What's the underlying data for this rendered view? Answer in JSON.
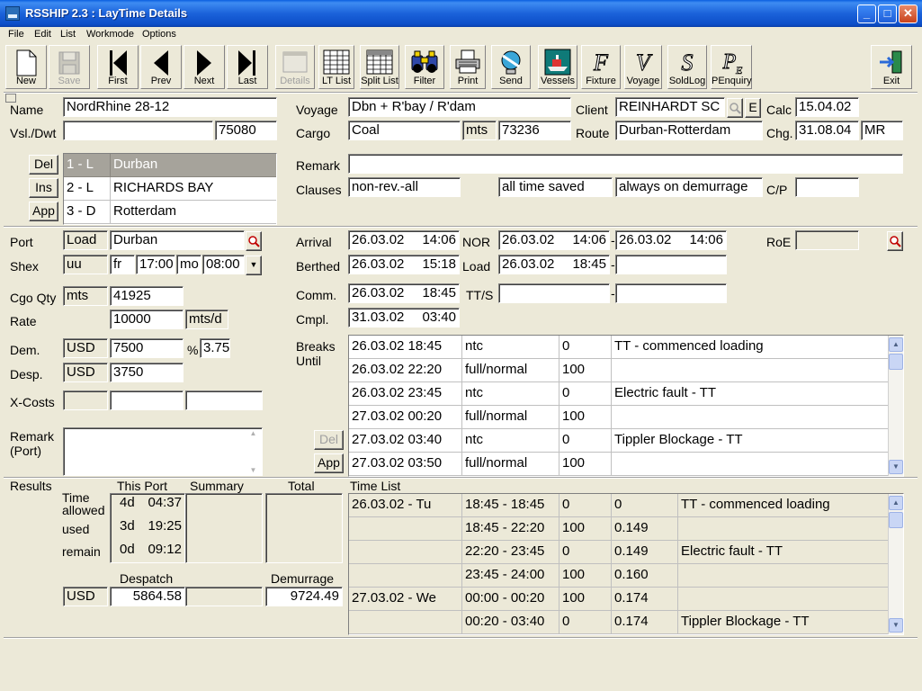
{
  "window": {
    "title": "RSSHIP 2.3 : LayTime Details"
  },
  "menu": [
    "File",
    "Edit",
    "List",
    "Workmode",
    "Options"
  ],
  "toolbar": {
    "new": "New",
    "save": "Save",
    "first": "First",
    "prev": "Prev",
    "next": "Next",
    "last": "Last",
    "details": "Details",
    "lt_list": "LT List",
    "split_list": "Split List",
    "filter": "Filter",
    "print": "Print",
    "send": "Send",
    "vessels": "Vessels",
    "fixture": "Fixture",
    "voyage": "Voyage",
    "soldlog": "SoldLog",
    "penquiry": "PEnquiry",
    "exit": "Exit"
  },
  "header": {
    "name_label": "Name",
    "name_value": "NordRhine 28-12",
    "vsl_dwt_label": "Vsl./Dwt",
    "vsl_value": "",
    "dwt_value": "75080",
    "voyage_label": "Voyage",
    "voyage_value": "Dbn + R'bay / R'dam",
    "cargo_label": "Cargo",
    "cargo_value": "Coal",
    "cargo_unit": "mts",
    "cargo_qty": "73236",
    "client_label": "Client",
    "client_value": "REINHARDT SC",
    "client_e_button": "E",
    "route_label": "Route",
    "route_value": "Durban-Rotterdam",
    "calc_label": "Calc",
    "calc_value": "15.04.02",
    "chg_label": "Chg.",
    "chg_value": "31.08.04",
    "chg_user": "MR",
    "remark_label": "Remark",
    "remark_value": "",
    "clauses_label": "Clauses",
    "clauses": [
      "non-rev.-all",
      "all time saved",
      "always on demurrage"
    ],
    "cp_label": "C/P",
    "cp_value": ""
  },
  "ports": {
    "del_button": "Del",
    "ins_button": "Ins",
    "app_button": "App",
    "rows": [
      {
        "code": "1 - L",
        "name": "Durban"
      },
      {
        "code": "2 - L",
        "name": "RICHARDS BAY"
      },
      {
        "code": "3 - D",
        "name": "Rotterdam"
      }
    ]
  },
  "port_detail": {
    "port_label": "Port",
    "port_type": "Load",
    "port_name": "Durban",
    "shex_label": "Shex",
    "shex_value": "uu",
    "shex_from_day": "fr",
    "shex_from_time": "17:00",
    "shex_to_day": "mo",
    "shex_to_time": "08:00",
    "cgo_qty_label": "Cgo Qty",
    "cgo_unit": "mts",
    "cgo_qty": "41925",
    "rate_label": "Rate",
    "rate_value": "10000",
    "rate_unit": "mts/d",
    "dem_label": "Dem.",
    "dem_currency": "USD",
    "dem_value": "7500",
    "pct_label": "%",
    "pct_value": "3.75",
    "desp_label": "Desp.",
    "desp_currency": "USD",
    "desp_value": "3750",
    "xcosts_label": "X-Costs",
    "remark_port_label_1": "Remark",
    "remark_port_label_2": "(Port)",
    "arrival_label": "Arrival",
    "arrival_date": "26.03.02",
    "arrival_time": "14:06",
    "nor_label": "NOR",
    "nor_from_date": "26.03.02",
    "nor_from_time": "14:06",
    "nor_to_date": "26.03.02",
    "nor_to_time": "14:06",
    "roe_label": "RoE",
    "roe_value": "",
    "berthed_label": "Berthed",
    "berthed_date": "26.03.02",
    "berthed_time": "15:18",
    "load_label": "Load",
    "load_date": "26.03.02",
    "load_time": "18:45",
    "comm_label": "Comm.",
    "comm_date": "26.03.02",
    "comm_time": "18:45",
    "tts_label": "TT/S",
    "cmpl_label": "Cmpl.",
    "cmpl_date": "31.03.02",
    "cmpl_time": "03:40",
    "dash": "-"
  },
  "breaks": {
    "label_1": "Breaks",
    "label_2": "Until",
    "del_button": "Del",
    "app_button": "App",
    "rows": [
      {
        "date": "26.03.02",
        "time": "18:45",
        "type": "ntc",
        "pct": "0",
        "desc": "TT - commenced loading"
      },
      {
        "date": "26.03.02",
        "time": "22:20",
        "type": "full/normal",
        "pct": "100",
        "desc": ""
      },
      {
        "date": "26.03.02",
        "time": "23:45",
        "type": "ntc",
        "pct": "0",
        "desc": "Electric fault - TT"
      },
      {
        "date": "27.03.02",
        "time": "00:20",
        "type": "full/normal",
        "pct": "100",
        "desc": ""
      },
      {
        "date": "27.03.02",
        "time": "03:40",
        "type": "ntc",
        "pct": "0",
        "desc": "Tippler Blockage - TT"
      },
      {
        "date": "27.03.02",
        "time": "03:50",
        "type": "full/normal",
        "pct": "100",
        "desc": ""
      }
    ]
  },
  "results": {
    "label": "Results",
    "this_port_label": "This Port",
    "summary_label": "Summary",
    "total_label": "Total",
    "time_allowed_label_1": "Time",
    "time_allowed_label_2": "allowed",
    "used_label": "used",
    "remain_label": "remain",
    "allowed_d": "4d",
    "allowed_t": "04:37",
    "used_d": "3d",
    "used_t": "19:25",
    "remain_d": "0d",
    "remain_t": "09:12",
    "despatch_label": "Despatch",
    "demurrage_label": "Demurrage",
    "currency": "USD",
    "despatch_value": "5864.58",
    "demurrage_value": "9724.49"
  },
  "timelist": {
    "label": "Time List",
    "rows": [
      {
        "day": "26.03.02  -  Tu",
        "range": "18:45 - 18:45",
        "pct": "0",
        "val": "0",
        "desc": "TT - commenced loading"
      },
      {
        "day": "",
        "range": "18:45 - 22:20",
        "pct": "100",
        "val": "0.149",
        "desc": ""
      },
      {
        "day": "",
        "range": "22:20 - 23:45",
        "pct": "0",
        "val": "0.149",
        "desc": "Electric fault - TT"
      },
      {
        "day": "",
        "range": "23:45 - 24:00",
        "pct": "100",
        "val": "0.160",
        "desc": ""
      },
      {
        "day": "27.03.02  -  We",
        "range": "00:00 - 00:20",
        "pct": "100",
        "val": "0.174",
        "desc": ""
      },
      {
        "day": "",
        "range": "00:20 - 03:40",
        "pct": "0",
        "val": "0.174",
        "desc": "Tippler Blockage - TT"
      }
    ]
  }
}
